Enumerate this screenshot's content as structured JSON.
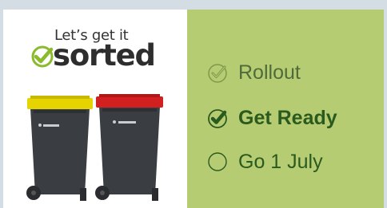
{
  "logo": {
    "line1": "Let’s get it",
    "line2": "sorted"
  },
  "statuses": [
    {
      "label": "Rollout",
      "state": "done"
    },
    {
      "label": "Get Ready",
      "state": "current"
    },
    {
      "label": "Go 1 July",
      "state": "upcoming"
    }
  ],
  "colors": {
    "background": "#d4dde3",
    "panel_green": "#b6cc73",
    "accent_green": "#2b5a1f",
    "bin_body": "#3a3d42",
    "lid_yellow": "#e6d400",
    "lid_red": "#d21f1f"
  }
}
